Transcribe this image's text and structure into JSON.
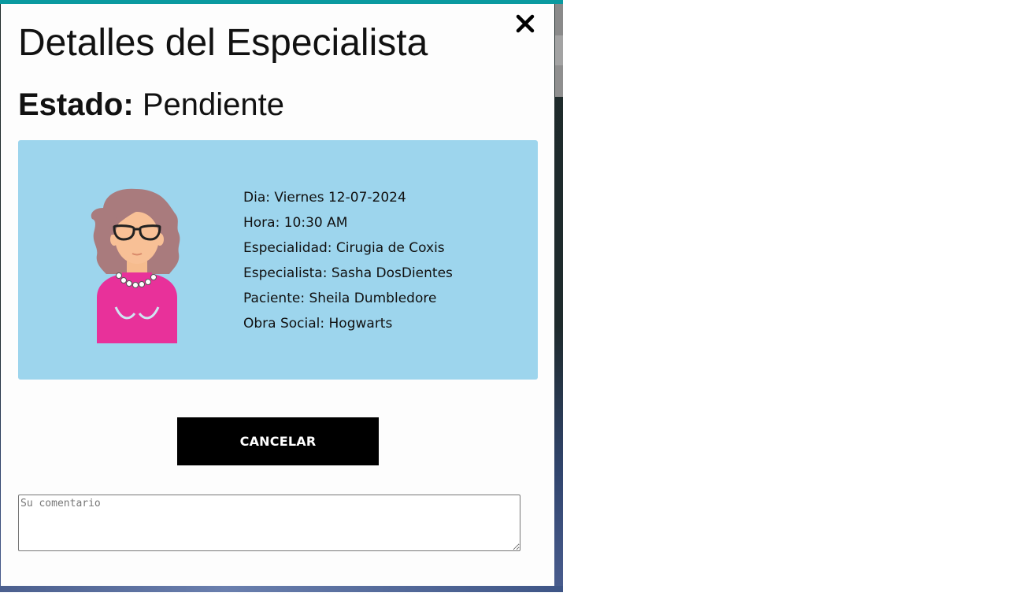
{
  "modal": {
    "title": "Detalles del Especialista",
    "estado_label": "Estado:",
    "estado_value": "Pendiente",
    "close_icon": "close-icon"
  },
  "details": {
    "items": [
      "Dia: Viernes 12-07-2024",
      "Hora: 10:30 AM",
      "Especialidad: Cirugia de Coxis",
      "Especialista: Sasha DosDientes",
      "Paciente: Sheila Dumbledore",
      "Obra Social: Hogwarts"
    ]
  },
  "actions": {
    "cancel_label": "CANCELAR"
  },
  "comment": {
    "placeholder": "Su comentario",
    "value": ""
  },
  "colors": {
    "card_background": "#9dd5ed",
    "cancel_button": "#000000",
    "header_accent": "#0a9aa0"
  }
}
